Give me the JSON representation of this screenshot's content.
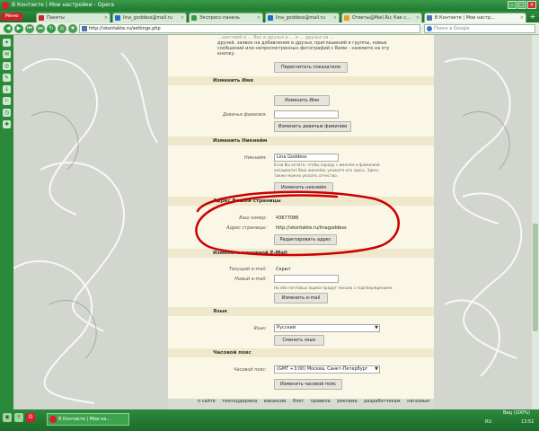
{
  "window": {
    "title": "В Контакте | Мои настройки - Opera"
  },
  "menu_label": "Меню",
  "tabs": [
    {
      "label": "Пакеты"
    },
    {
      "label": "lina_goddess@mail.ru"
    },
    {
      "label": "Экспресс-панель"
    },
    {
      "label": "lina_goddess@mail.ru"
    },
    {
      "label": "Ответы@Mail.Ru: Как с..."
    },
    {
      "label": "В Контакте | Мои настр..."
    }
  ],
  "address": {
    "url": "http://vkontakte.ru/settings.php"
  },
  "search": {
    "placeholder": "Поиск в Google"
  },
  "top_text": [
    "...шествий и ... Вас в друзья и ... и ... друзья за ... ",
    "друзей, заявок на добавление в друзья, приглашений в группы, новых",
    "сообщений или непросмотренных фотографий с Вами - нажмите на эту",
    "кнопку."
  ],
  "recount_button": "Пересчитать показатели",
  "name_section": {
    "title": "Изменить Имя",
    "change_name_button": "Изменить Имя",
    "maiden_label": "Девичья фамилия:",
    "maiden_button": "Изменить девичью фамилию"
  },
  "nick_section": {
    "title": "Изменить Никнейм",
    "nick_label": "Никнейм:",
    "nick_value": "Lina Goddess",
    "note": [
      "Если Вы хотите, чтобы наряду с именем и фамилией",
      "указывался Ваш никнейм, укажите его здесь. Здесь",
      "также можно указать отчество."
    ],
    "button": "Изменить никнейм"
  },
  "address_section": {
    "title": "Адрес Вашей страницы",
    "number_label": "Ваш номер:",
    "number_value": "43677086",
    "page_label": "Адрес страницы:",
    "page_value": "http://vkontakte.ru/linagoddess",
    "button": "Редактировать адрес"
  },
  "email_section": {
    "title": "Изменить основной E-Mail",
    "current_label": "Текущий e-mail:",
    "current_value": "Скрыт",
    "new_label": "Новый e-mail:",
    "note": "На оба почтовых ящика придут письма с подтверждением.",
    "button": "Изменить e-mail"
  },
  "language_section": {
    "title": "Язык",
    "label": "Язык:",
    "value": "Русский",
    "button": "Сменить язык"
  },
  "timezone_section": {
    "title": "Часовой пояс",
    "label": "Часовой пояс:",
    "value": "(GMT +3:00) Москва, Санкт-Петербург",
    "button": "Изменить часовой пояс"
  },
  "footer": [
    "о сайте",
    "техподдержка",
    "вакансии",
    "блог",
    "правила",
    "реклама",
    "разработчикам",
    "нагазиын"
  ],
  "taskbar": {
    "task_label": "В Контакте | Мои на...",
    "zoom": "Вид (100%)",
    "lang": "RU",
    "time": "13:51"
  },
  "colors": {
    "accent": "#2a8a3a",
    "annotation": "#cc0000",
    "content_bg": "#fbf7e6",
    "section_bg": "#efe8cd"
  }
}
